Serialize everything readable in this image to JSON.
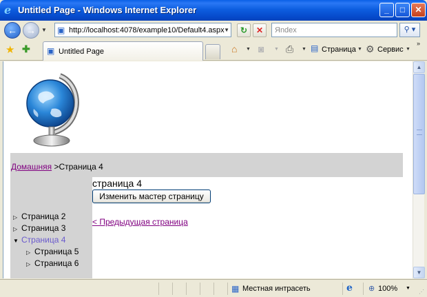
{
  "window": {
    "title": "Untitled Page - Windows Internet Explorer",
    "buttons": {
      "minimize": "_",
      "maximize": "□",
      "close": "✕"
    }
  },
  "address_bar": {
    "url": "http://localhost:4078/example10/Default4.aspx",
    "search_placeholder": "Яndex"
  },
  "tabs": [
    {
      "label": "Untitled Page"
    }
  ],
  "command_bar": {
    "page_label": "Страница",
    "tools_label": "Сервис"
  },
  "content": {
    "breadcrumb": {
      "home": "Домашняя",
      "separator": " >",
      "current": "Страница 4"
    },
    "heading": "страница 4",
    "change_master_button": "Изменить мастер страницу",
    "prev_link": "< Предыдущая страница",
    "tree": [
      {
        "label": "Страница 2",
        "level": 0,
        "expanded": false,
        "selected": false
      },
      {
        "label": "Страница 3",
        "level": 0,
        "expanded": false,
        "selected": false
      },
      {
        "label": "Страница 4",
        "level": 0,
        "expanded": true,
        "selected": true
      },
      {
        "label": "Страница 5",
        "level": 1,
        "expanded": false,
        "selected": false
      },
      {
        "label": "Страница 6",
        "level": 1,
        "expanded": false,
        "selected": false
      }
    ]
  },
  "status_bar": {
    "zone": "Местная интрасеть",
    "zoom": "100%"
  },
  "colors": {
    "visited_link": "#800080",
    "selected_node": "#6a5acd",
    "panel_gray": "#d3d3d3",
    "titlebar_blue": "#0548c9"
  },
  "icons": {
    "logo": "globe-icon",
    "back": "back-arrow-icon",
    "forward": "forward-arrow-icon",
    "refresh": "refresh-icon",
    "stop": "stop-icon",
    "search": "search-icon",
    "favorites": "favorites-star-icon",
    "add_favorites": "add-favorites-icon",
    "home": "home-icon",
    "feeds": "feeds-icon",
    "print": "print-icon",
    "page": "page-icon",
    "tools": "gear-icon",
    "zone": "intranet-zone-icon",
    "zoom": "zoom-icon"
  }
}
